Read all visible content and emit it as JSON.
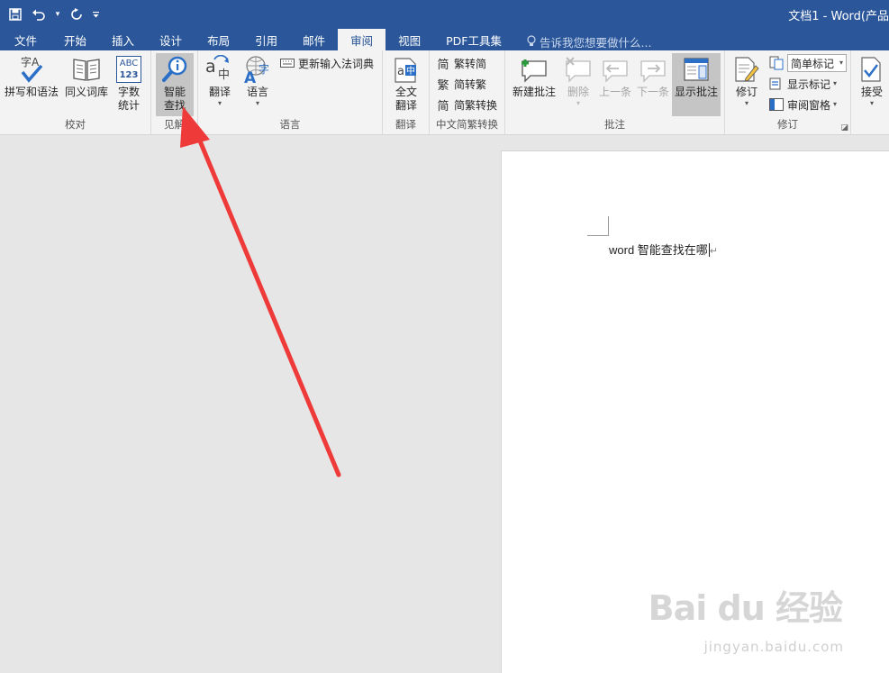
{
  "title_bar": {
    "doc_title": "文档1 - Word(产品"
  },
  "qat": {
    "save_icon": "save-icon",
    "undo_icon": "undo-icon",
    "redo_icon": "redo-icon",
    "customize_icon": "customize-icon"
  },
  "tabs": [
    {
      "label": "文件"
    },
    {
      "label": "开始"
    },
    {
      "label": "插入"
    },
    {
      "label": "设计"
    },
    {
      "label": "布局"
    },
    {
      "label": "引用"
    },
    {
      "label": "邮件"
    },
    {
      "label": "审阅",
      "active": true
    },
    {
      "label": "视图"
    },
    {
      "label": "PDF工具集"
    }
  ],
  "tell_me": "告诉我您想要做什么...",
  "ribbon": {
    "proofing": {
      "label": "校对",
      "spelling": "拼写和语法",
      "thesaurus": "同义词库",
      "wordcount_line1": "字数",
      "wordcount_line2": "统计",
      "wordcount_icon_top": "ABC",
      "wordcount_icon_bottom": "123"
    },
    "insights": {
      "label": "见解",
      "smart_lookup_line1": "智能",
      "smart_lookup_line2": "查找"
    },
    "language": {
      "label": "语言",
      "translate": "翻译",
      "language": "语言",
      "update_ime": "更新输入法词典"
    },
    "translation": {
      "label": "翻译",
      "full_line1": "全文",
      "full_line2": "翻译"
    },
    "chinese_conversion": {
      "label": "中文简繁转换",
      "to_traditional": "繁转简",
      "to_simplified": "简转繁",
      "convert": "简繁转换"
    },
    "comments": {
      "label": "批注",
      "new": "新建批注",
      "delete": "删除",
      "previous": "上一条",
      "next": "下一条",
      "show": "显示批注"
    },
    "tracking": {
      "label": "修订",
      "track_changes": "修订",
      "markup_select": "简单标记",
      "show_markup": "显示标记",
      "review_pane": "审阅窗格"
    },
    "changes": {
      "accept": "接受"
    }
  },
  "document": {
    "text": "word 智能查找在哪",
    "para_mark": "↵"
  },
  "watermark": {
    "main": "Bai du 经验",
    "sub": "jingyan.baidu.com"
  },
  "colors": {
    "title_bar": "#2b579a",
    "ribbon": "#f3f3f3",
    "arrow": "#ef3a3a"
  }
}
